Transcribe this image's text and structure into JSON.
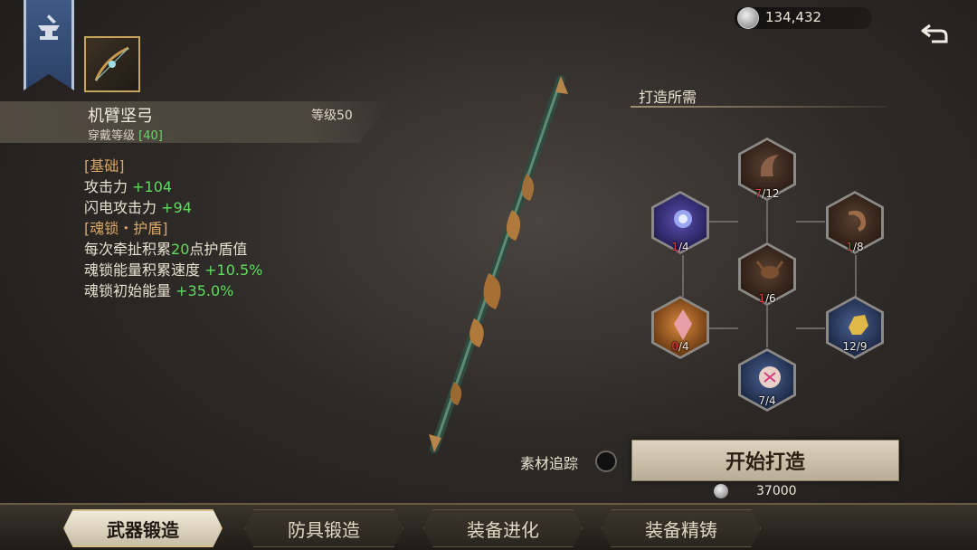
{
  "currency": {
    "amount": "134,432",
    "icon": "silver-coin-icon"
  },
  "item": {
    "name": "机臂坚弓",
    "level_label": "等级50",
    "wear_label": "穿戴等级",
    "wear_value": "[40]"
  },
  "stats": {
    "basic_header": "[基础]",
    "attack_label": "攻击力",
    "attack_value": "+104",
    "lightning_label": "闪电攻击力",
    "lightning_value": "+94",
    "soul_header": "[魂锁・护盾]",
    "soul_line1_a": "每次牵扯积累",
    "soul_line1_b": "20",
    "soul_line1_c": "点护盾值",
    "soul_line2_label": "魂锁能量积累速度",
    "soul_line2_value": "+10.5%",
    "soul_line3_label": "魂锁初始能量",
    "soul_line3_value": "+35.0%"
  },
  "requirements": {
    "title": "打造所需",
    "materials": [
      {
        "have": "7",
        "need": "/12",
        "red": true
      },
      {
        "have": "1",
        "need": "/4",
        "red": true
      },
      {
        "have": "1",
        "need": "/8",
        "red": true
      },
      {
        "have": "1",
        "need": "/6",
        "red": true
      },
      {
        "have": "0",
        "need": "/4",
        "red": true
      },
      {
        "have": "12",
        "need": "/9",
        "red": false
      },
      {
        "have": "7",
        "need": "/4",
        "red": false
      }
    ]
  },
  "track": {
    "label": "素材追踪"
  },
  "forge": {
    "label": "开始打造",
    "cost": "37000"
  },
  "tabs": [
    {
      "label": "武器锻造",
      "active": true
    },
    {
      "label": "防具锻造",
      "active": false
    },
    {
      "label": "装备进化",
      "active": false
    },
    {
      "label": "装备精铸",
      "active": false
    }
  ]
}
